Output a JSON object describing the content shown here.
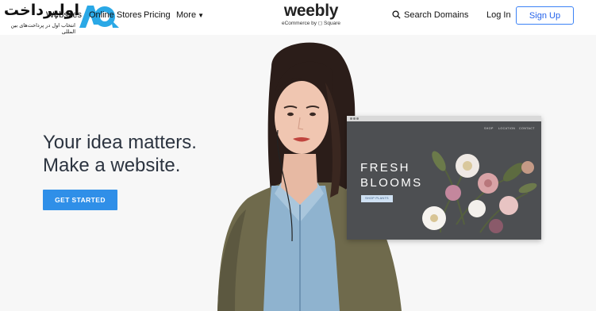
{
  "watermark": {
    "text": "اولپرداخت",
    "subtext": "انتخاب اول در پرداخت‌های بین المللی"
  },
  "nav": {
    "websites": "Websites",
    "stores": "Online Stores",
    "pricing": "Pricing",
    "more": "More",
    "more_icon": "chevron-down-icon"
  },
  "logo": {
    "wordmark": "weebly",
    "tagline": "eCommerce by ◻ Square"
  },
  "header_right": {
    "search_label": "Search Domains",
    "search_icon": "search-icon",
    "login_label": "Log In",
    "signup_label": "Sign Up"
  },
  "hero": {
    "headline_line1": "Your idea matters.",
    "headline_line2": "Make a website.",
    "cta_label": "GET STARTED"
  },
  "mockup": {
    "nav_items": [
      "SHOP",
      "LOCATION",
      "CONTACT"
    ],
    "title_line1": "FRESH",
    "title_line2": "BLOOMS",
    "button_label": "SHOP PLANTS"
  },
  "colors": {
    "accent": "#2f8fe8",
    "signup_border": "#3b82f6",
    "hero_bg": "#f7f7f7",
    "mockup_bg": "#4d4f52"
  }
}
